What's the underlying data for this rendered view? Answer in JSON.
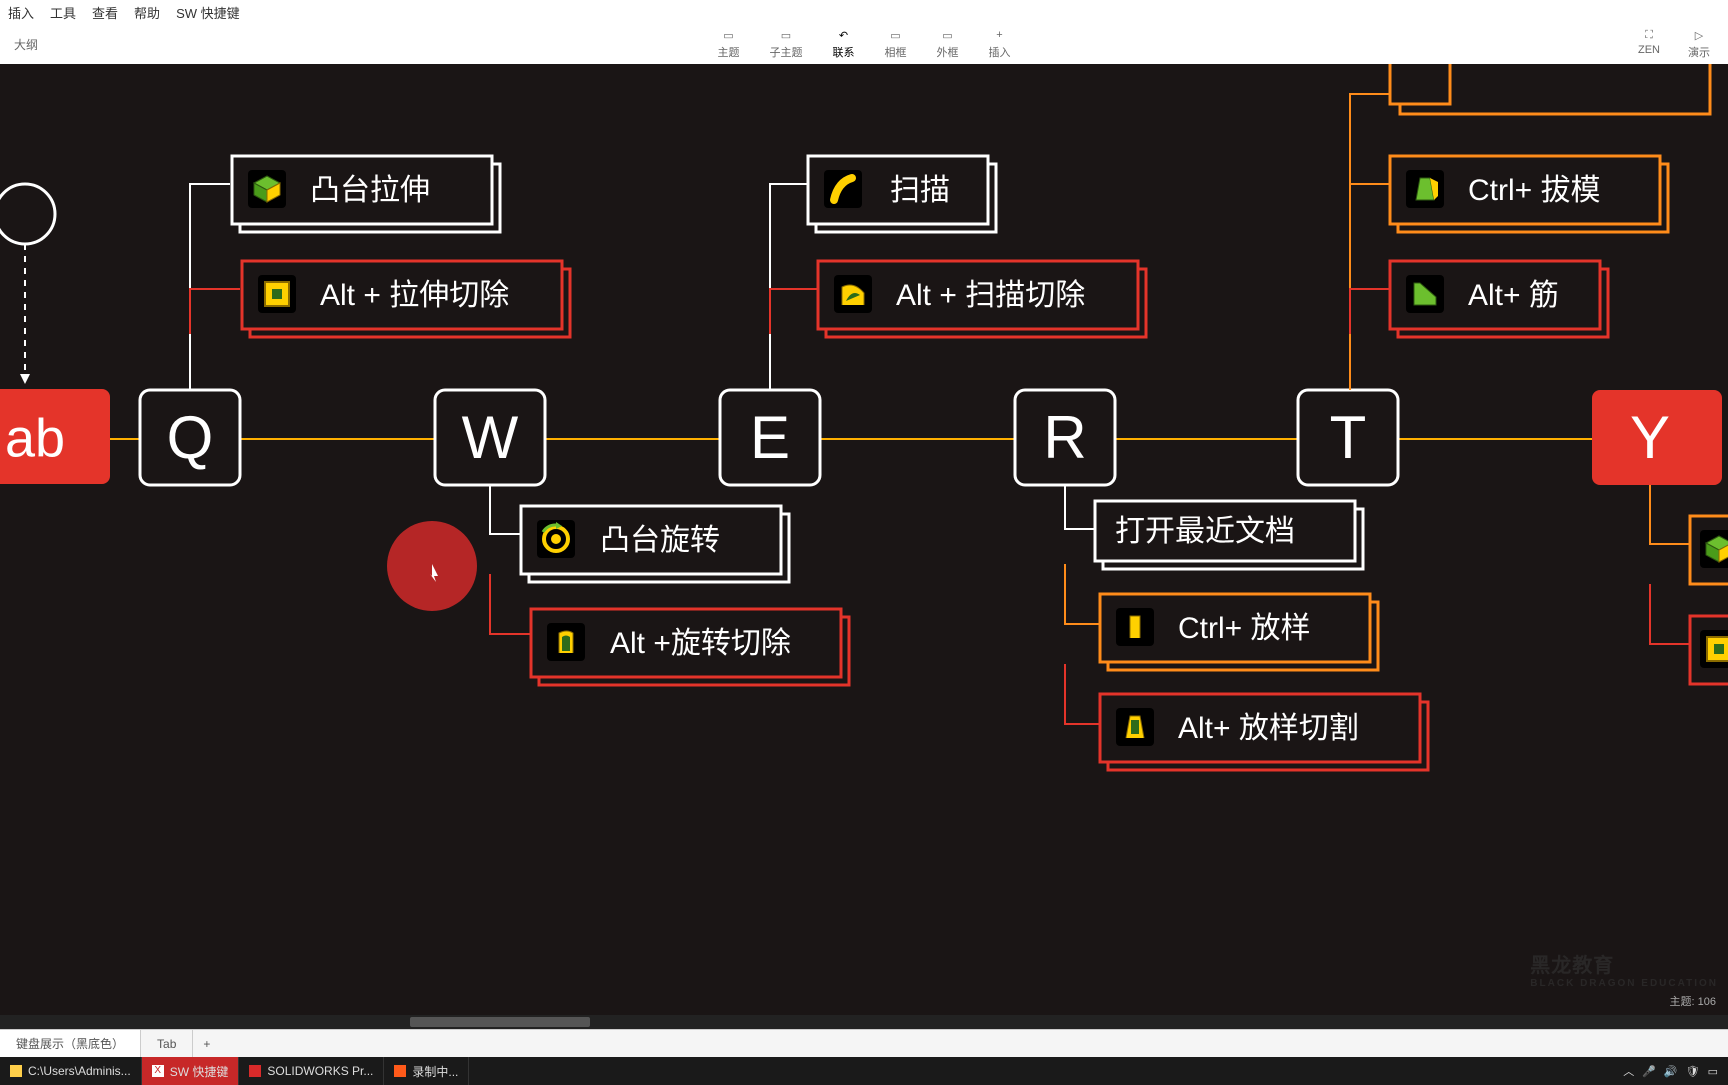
{
  "menubar": [
    "插入",
    "工具",
    "查看",
    "帮助",
    "SW 快捷键"
  ],
  "toolbar_left": "大纲",
  "toolbar_center": [
    {
      "label": "主题"
    },
    {
      "label": "子主题"
    },
    {
      "label": "联系",
      "active": true
    },
    {
      "label": "相框"
    },
    {
      "label": "外框"
    },
    {
      "label": "插入"
    }
  ],
  "toolbar_right": [
    {
      "label": "ZEN"
    },
    {
      "label": "演示"
    }
  ],
  "keys": {
    "tab": "ab",
    "q": "Q",
    "w": "W",
    "e": "E",
    "r": "R",
    "t": "T",
    "y": "Y"
  },
  "nodes": {
    "q1": "凸台拉伸",
    "q2": "Alt + 拉伸切除",
    "e1": "扫描",
    "e2": "Alt + 扫描切除",
    "t1": "Ctrl+ 拔模",
    "t2": "Alt+ 筋",
    "w1": "凸台旋转",
    "w2": "Alt +旋转切除",
    "r1": "打开最近文档",
    "r2": "Ctrl+ 放样",
    "r3": "Alt+ 放样切割"
  },
  "tabs": {
    "t1": "键盘展示（黑底色）",
    "t2": "Tab"
  },
  "taskbar": {
    "explorer": "C:\\Users\\Adminis...",
    "xmind": "SW 快捷键",
    "sw": "SOLIDWORKS Pr...",
    "rec": "录制中..."
  },
  "watermark": {
    "top": "黑龙教育",
    "bottom": "BLACK DRAGON EDUCATION"
  },
  "topiccount": "主题: 106"
}
